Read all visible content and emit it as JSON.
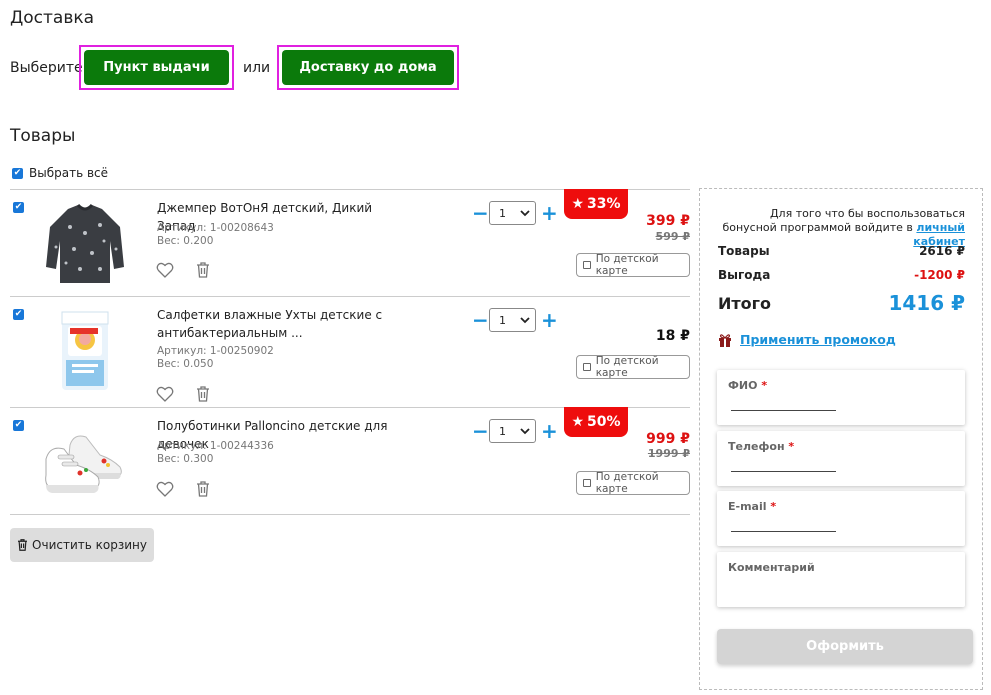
{
  "delivery": {
    "title": "Доставка",
    "choose_label": "Выберите",
    "or_label": "или",
    "pickup_button": "Пункт выдачи",
    "home_button": "Доставку до дома"
  },
  "goods": {
    "title": "Товары",
    "select_all": "Выбрать всё",
    "items": [
      {
        "name": "Джемпер ВотОнЯ детский, Дикий Запад",
        "article": "Артикул: 1-00208643",
        "weight": "Вес: 0.200",
        "qty": "1",
        "discount": "33%",
        "price": "399 ₽",
        "old_price": "599 ₽",
        "card_label": "По детской карте",
        "image_icon": "sweater-image"
      },
      {
        "name": "Салфетки влажные Ухты детские с антибактериальным ...",
        "article": "Артикул: 1-00250902",
        "weight": "Вес: 0.050",
        "qty": "1",
        "price": "18 ₽",
        "card_label": "По детской карте",
        "image_icon": "wipes-package-image"
      },
      {
        "name": "Полуботинки Palloncino детские для девочек",
        "article": "Артикул: 1-00244336",
        "weight": "Вес: 0.300",
        "qty": "1",
        "discount": "50%",
        "price": "999 ₽",
        "old_price": "1999 ₽",
        "card_label": "По детской карте",
        "image_icon": "sneakers-image"
      }
    ],
    "clear_button": "Очистить корзину"
  },
  "summary": {
    "bonus_text": "Для того что бы воспользоваться бонусной программой войдите в",
    "bonus_link": "личный кабинет",
    "goods_label": "Товары",
    "goods_value": "2616 ₽",
    "benefit_label": "Выгода",
    "benefit_value": "-1200 ₽",
    "total_label": "Итого",
    "total_value": "1416 ₽",
    "promo_link": "Применить промокод",
    "fields": {
      "fio": "ФИО",
      "phone": "Телефон",
      "email": "E-mail",
      "comment": "Комментарий",
      "required_mark": "*"
    },
    "submit": "Оформить"
  },
  "colors": {
    "green_button": "#0b7a0b",
    "highlight_frame": "#e020e0",
    "accent_blue": "#1a91d9",
    "price_red": "#dd1111",
    "badge_red": "#ee0d0d"
  }
}
